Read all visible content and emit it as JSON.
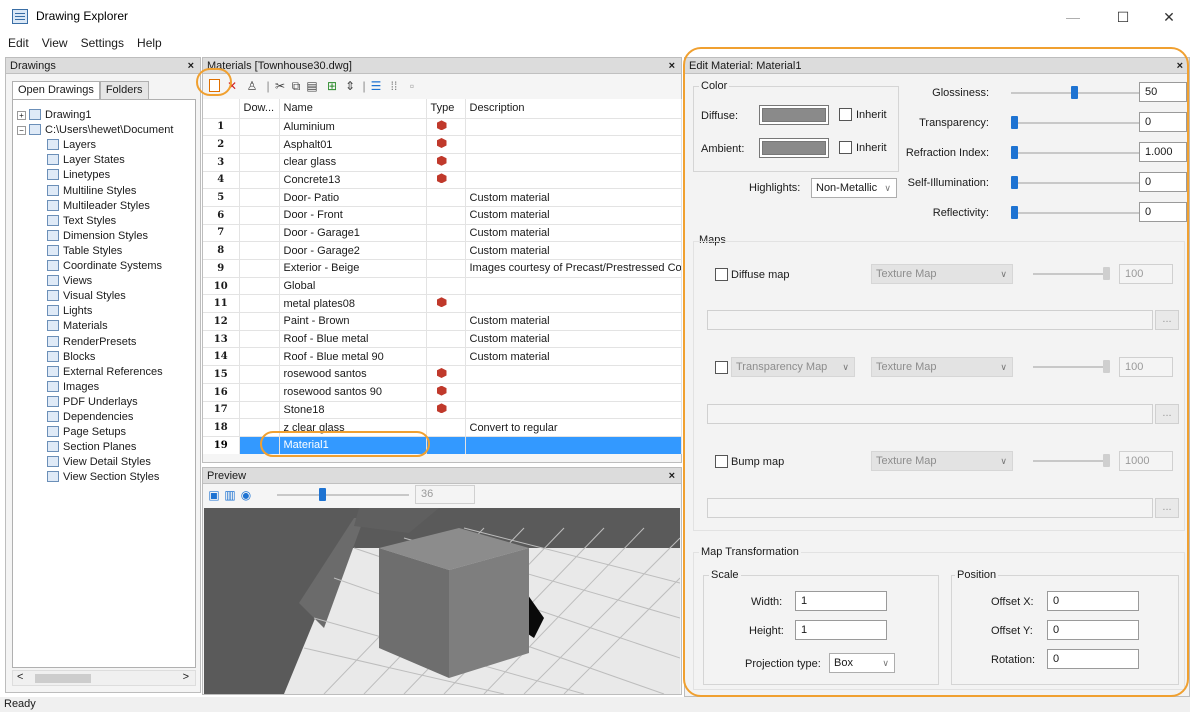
{
  "window": {
    "title": "Drawing Explorer",
    "minimize": "—",
    "maximize": "☐",
    "close": "✕"
  },
  "menu": [
    "Edit",
    "View",
    "Settings",
    "Help"
  ],
  "drawings": {
    "header": "Drawings",
    "close": "×",
    "tabs": [
      "Open Drawings",
      "Folders"
    ],
    "tree": [
      {
        "label": "Drawing1",
        "icon": "drawing-icon",
        "expander": "+"
      },
      {
        "label": "C:\\Users\\hewet\\Document",
        "icon": "drawing-icon",
        "expander": "−"
      },
      {
        "label": "Layers",
        "icon": "layers-icon"
      },
      {
        "label": "Layer States",
        "icon": "layer-states-icon"
      },
      {
        "label": "Linetypes",
        "icon": "linetypes-icon"
      },
      {
        "label": "Multiline Styles",
        "icon": "multiline-icon"
      },
      {
        "label": "Multileader Styles",
        "icon": "multileader-icon"
      },
      {
        "label": "Text Styles",
        "icon": "text-styles-icon"
      },
      {
        "label": "Dimension Styles",
        "icon": "dimension-icon"
      },
      {
        "label": "Table Styles",
        "icon": "table-icon"
      },
      {
        "label": "Coordinate Systems",
        "icon": "ucs-icon"
      },
      {
        "label": "Views",
        "icon": "views-icon"
      },
      {
        "label": "Visual Styles",
        "icon": "visual-styles-icon"
      },
      {
        "label": "Lights",
        "icon": "lights-icon"
      },
      {
        "label": "Materials",
        "icon": "materials-icon"
      },
      {
        "label": "RenderPresets",
        "icon": "render-icon"
      },
      {
        "label": "Blocks",
        "icon": "blocks-icon"
      },
      {
        "label": "External References",
        "icon": "xref-icon"
      },
      {
        "label": "Images",
        "icon": "images-icon"
      },
      {
        "label": "PDF Underlays",
        "icon": "pdf-icon"
      },
      {
        "label": "Dependencies",
        "icon": "dependencies-icon"
      },
      {
        "label": "Page Setups",
        "icon": "page-setup-icon"
      },
      {
        "label": "Section Planes",
        "icon": "section-icon"
      },
      {
        "label": "View Detail Styles",
        "icon": "detail-icon"
      },
      {
        "label": "View Section Styles",
        "icon": "view-section-icon"
      }
    ],
    "scroll_left": "<",
    "scroll_right": ">"
  },
  "materials": {
    "header": "Materials [Townhouse30.dwg]",
    "close": "×",
    "columns": [
      "",
      "Dow...",
      "Name",
      "Type",
      "Description"
    ],
    "rows": [
      {
        "n": "1",
        "name": "Aluminium",
        "typed": true,
        "desc": ""
      },
      {
        "n": "2",
        "name": "Asphalt01",
        "typed": true,
        "desc": ""
      },
      {
        "n": "3",
        "name": "clear glass",
        "typed": true,
        "desc": ""
      },
      {
        "n": "4",
        "name": "Concrete13",
        "typed": true,
        "desc": ""
      },
      {
        "n": "5",
        "name": "Door- Patio",
        "typed": false,
        "desc": "Custom material"
      },
      {
        "n": "6",
        "name": "Door - Front",
        "typed": false,
        "desc": "Custom material"
      },
      {
        "n": "7",
        "name": "Door - Garage1",
        "typed": false,
        "desc": "Custom material"
      },
      {
        "n": "8",
        "name": "Door - Garage2",
        "typed": false,
        "desc": "Custom material"
      },
      {
        "n": "9",
        "name": "Exterior - Beige",
        "typed": false,
        "desc": "Images courtesy of Precast/Prestressed Con"
      },
      {
        "n": "10",
        "name": "Global",
        "typed": false,
        "desc": ""
      },
      {
        "n": "11",
        "name": "metal plates08",
        "typed": true,
        "desc": ""
      },
      {
        "n": "12",
        "name": "Paint - Brown",
        "typed": false,
        "desc": "Custom material"
      },
      {
        "n": "13",
        "name": "Roof - Blue metal",
        "typed": false,
        "desc": "Custom material"
      },
      {
        "n": "14",
        "name": "Roof - Blue metal 90",
        "typed": false,
        "desc": "Custom material"
      },
      {
        "n": "15",
        "name": "rosewood santos",
        "typed": true,
        "desc": ""
      },
      {
        "n": "16",
        "name": "rosewood santos 90",
        "typed": true,
        "desc": ""
      },
      {
        "n": "17",
        "name": "Stone18",
        "typed": true,
        "desc": ""
      },
      {
        "n": "18",
        "name": "z clear glass",
        "typed": false,
        "desc": "Convert to regular"
      },
      {
        "n": "19",
        "name": "Material1",
        "typed": false,
        "desc": "",
        "selected": true
      }
    ]
  },
  "preview": {
    "header": "Preview",
    "close": "×",
    "size_value": "36",
    "size_level": 0.33
  },
  "edit": {
    "header": "Edit Material: Material1",
    "close": "×",
    "color_group": "Color",
    "diffuse_label": "Diffuse:",
    "ambient_label": "Ambient:",
    "inherit_label": "Inherit",
    "highlights_label": "Highlights:",
    "highlights_value": "Non-Metallic",
    "props": [
      {
        "label": "Glossiness:",
        "value": "50",
        "level": 0.5
      },
      {
        "label": "Transparency:",
        "value": "0",
        "level": 0
      },
      {
        "label": "Refraction Index:",
        "value": "1.000",
        "level": 0
      },
      {
        "label": "Self-Illumination:",
        "value": "0",
        "level": 0
      },
      {
        "label": "Reflectivity:",
        "value": "0",
        "level": 0
      }
    ],
    "maps_group": "Maps",
    "diffuse_map_label": "Diffuse map",
    "transparency_map_label": "Transparency Map",
    "bump_map_label": "Bump map",
    "texture_map": "Texture Map",
    "diffuse_map_value": "100",
    "transparency_map_value": "100",
    "bump_map_value": "1000",
    "browse": "...",
    "transform_group": "Map Transformation",
    "scale_group": "Scale",
    "position_group": "Position",
    "width_label": "Width:",
    "width_value": "1",
    "height_label": "Height:",
    "height_value": "1",
    "projection_label": "Projection type:",
    "projection_value": "Box",
    "offx_label": "Offset X:",
    "offx_value": "0",
    "offy_label": "Offset Y:",
    "offy_value": "0",
    "rotation_label": "Rotation:",
    "rotation_value": "0"
  },
  "status": "Ready",
  "colors": {
    "accent": "#3399ff",
    "highlight_ring": "#f0a030",
    "slider_thumb": "#1e73d2"
  }
}
